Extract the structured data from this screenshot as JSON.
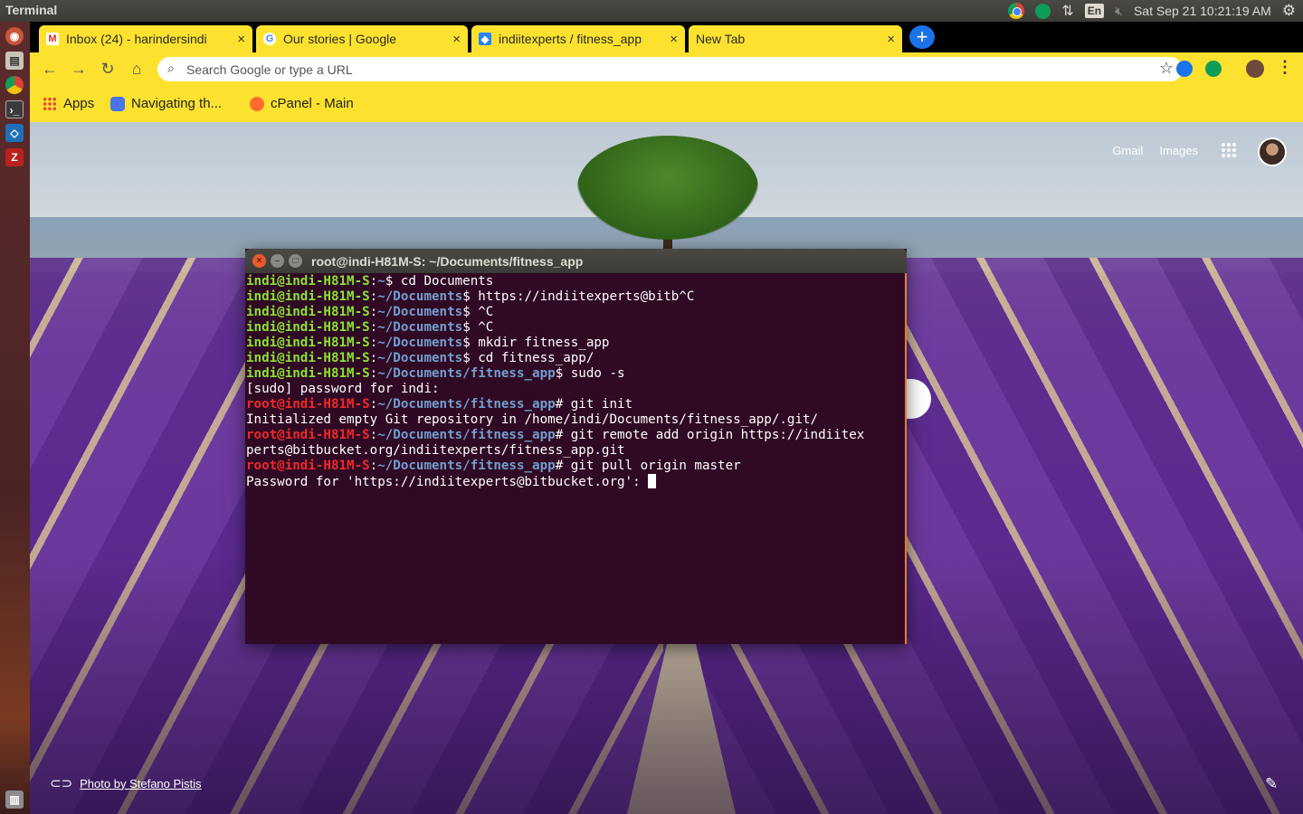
{
  "top_panel": {
    "app_name": "Terminal",
    "keyboard_layout": "En",
    "clock": "Sat Sep 21 10:21:19 AM",
    "icons": [
      "chrome-icon",
      "hangouts-icon",
      "network-icon",
      "keyboard-icon",
      "volume-muted-icon",
      "settings-gear-icon"
    ]
  },
  "launcher": {
    "icons": [
      "ubuntu-dash-icon",
      "files-icon",
      "chrome-icon",
      "terminal-icon",
      "vscode-icon",
      "filezilla-icon",
      "trash-icon"
    ]
  },
  "browser": {
    "tabs": [
      {
        "title": "Inbox (24) - harindersindi",
        "favicon": "gmail-icon",
        "close": "×"
      },
      {
        "title": "Our stories | Google",
        "favicon": "google-icon",
        "close": "×"
      },
      {
        "title": "indiitexperts / fitness_app",
        "favicon": "bitbucket-icon",
        "close": "×"
      },
      {
        "title": "New Tab",
        "favicon": "",
        "close": "×"
      }
    ],
    "new_tab_symbol": "+",
    "omnibox": {
      "placeholder": "Search Google or type a URL",
      "value": ""
    },
    "bookmarks": [
      {
        "label": "Apps",
        "icon": "apps-grid-icon"
      },
      {
        "label": "Navigating th...",
        "icon": "navigating-icon"
      },
      {
        "label": "cPanel - Main",
        "icon": "cpanel-icon"
      }
    ],
    "colors": {
      "theme": "#fce22f",
      "tab_strip": "#000000"
    }
  },
  "new_tab_page": {
    "links": [
      "Gmail",
      "Images"
    ],
    "photo_credit": "Photo by Stefano Pistis"
  },
  "terminal": {
    "title": "root@indi-H81M-S: ~/Documents/fitness_app",
    "lines": [
      [
        {
          "t": "indi@indi-H81M-S",
          "c": "pu"
        },
        {
          "t": ":",
          "c": ""
        },
        {
          "t": "~",
          "c": "pp"
        },
        {
          "t": "$ cd Documents",
          "c": ""
        }
      ],
      [
        {
          "t": "indi@indi-H81M-S",
          "c": "pu"
        },
        {
          "t": ":",
          "c": ""
        },
        {
          "t": "~/Documents",
          "c": "pp"
        },
        {
          "t": "$ https://indiitexperts@bitb^C",
          "c": ""
        }
      ],
      [
        {
          "t": "indi@indi-H81M-S",
          "c": "pu"
        },
        {
          "t": ":",
          "c": ""
        },
        {
          "t": "~/Documents",
          "c": "pp"
        },
        {
          "t": "$ ^C",
          "c": ""
        }
      ],
      [
        {
          "t": "indi@indi-H81M-S",
          "c": "pu"
        },
        {
          "t": ":",
          "c": ""
        },
        {
          "t": "~/Documents",
          "c": "pp"
        },
        {
          "t": "$ ^C",
          "c": ""
        }
      ],
      [
        {
          "t": "indi@indi-H81M-S",
          "c": "pu"
        },
        {
          "t": ":",
          "c": ""
        },
        {
          "t": "~/Documents",
          "c": "pp"
        },
        {
          "t": "$ mkdir fitness_app",
          "c": ""
        }
      ],
      [
        {
          "t": "indi@indi-H81M-S",
          "c": "pu"
        },
        {
          "t": ":",
          "c": ""
        },
        {
          "t": "~/Documents",
          "c": "pp"
        },
        {
          "t": "$ cd fitness_app/",
          "c": ""
        }
      ],
      [
        {
          "t": "indi@indi-H81M-S",
          "c": "pu"
        },
        {
          "t": ":",
          "c": ""
        },
        {
          "t": "~/Documents/fitness_app",
          "c": "pp"
        },
        {
          "t": "$ sudo -s",
          "c": ""
        }
      ],
      [
        {
          "t": "[sudo] password for indi:",
          "c": ""
        }
      ],
      [
        {
          "t": "root@indi-H81M-S",
          "c": "pr"
        },
        {
          "t": ":",
          "c": ""
        },
        {
          "t": "~/Documents/fitness_app",
          "c": "pp"
        },
        {
          "t": "# git init",
          "c": ""
        }
      ],
      [
        {
          "t": "Initialized empty Git repository in /home/indi/Documents/fitness_app/.git/",
          "c": ""
        }
      ],
      [
        {
          "t": "root@indi-H81M-S",
          "c": "pr"
        },
        {
          "t": ":",
          "c": ""
        },
        {
          "t": "~/Documents/fitness_app",
          "c": "pp"
        },
        {
          "t": "# git remote add origin https://indiitex",
          "c": ""
        }
      ],
      [
        {
          "t": "perts@bitbucket.org/indiitexperts/fitness_app.git",
          "c": ""
        }
      ],
      [
        {
          "t": "root@indi-H81M-S",
          "c": "pr"
        },
        {
          "t": ":",
          "c": ""
        },
        {
          "t": "~/Documents/fitness_app",
          "c": "pp"
        },
        {
          "t": "# git pull origin master",
          "c": ""
        }
      ],
      [
        {
          "t": "Password for 'https://indiitexperts@bitbucket.org': ",
          "c": ""
        }
      ]
    ],
    "colors": {
      "background": "#300a24",
      "user": "#8ae234",
      "path": "#729fcf",
      "root": "#ef2929"
    }
  }
}
